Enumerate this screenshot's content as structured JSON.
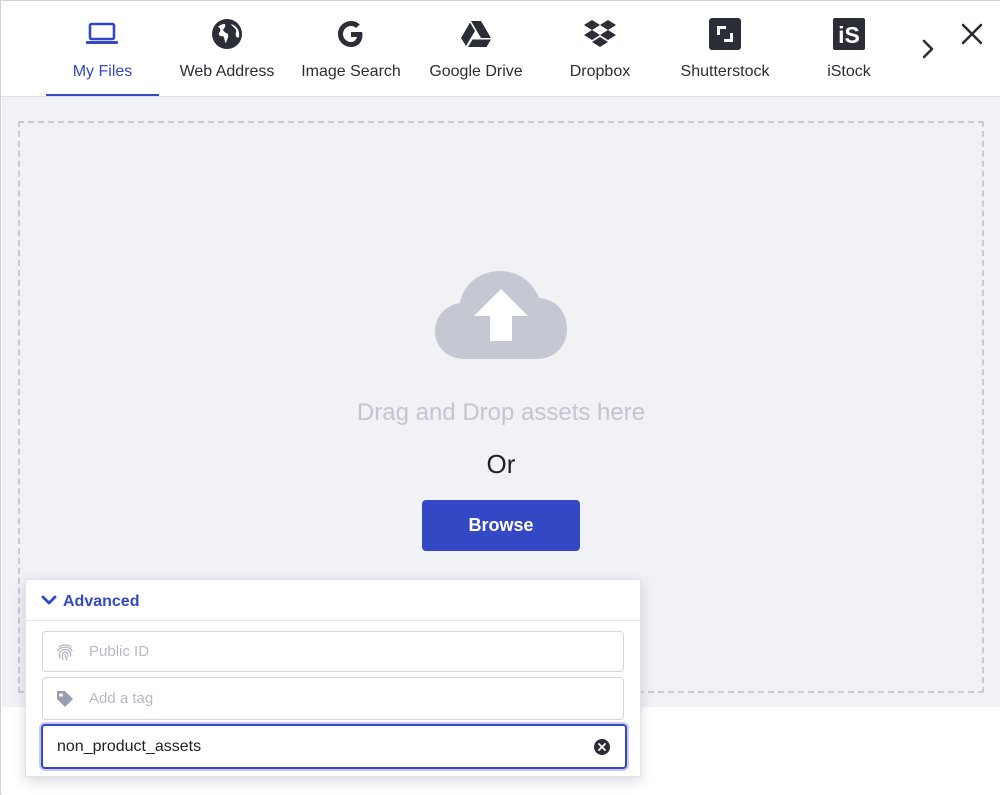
{
  "tabs": [
    {
      "id": "my-files",
      "label": "My Files",
      "icon": "laptop-icon",
      "active": true
    },
    {
      "id": "web-address",
      "label": "Web Address",
      "icon": "globe-icon",
      "active": false
    },
    {
      "id": "image-search",
      "label": "Image Search",
      "icon": "google-icon",
      "active": false
    },
    {
      "id": "google-drive",
      "label": "Google Drive",
      "icon": "google-drive-icon",
      "active": false
    },
    {
      "id": "dropbox",
      "label": "Dropbox",
      "icon": "dropbox-icon",
      "active": false
    },
    {
      "id": "shutterstock",
      "label": "Shutterstock",
      "icon": "shutterstock-icon",
      "active": false
    },
    {
      "id": "istock",
      "label": "iStock",
      "icon": "istock-icon",
      "active": false
    }
  ],
  "istock_logo_text": "iS",
  "dropzone": {
    "drag_text": "Drag and Drop assets here",
    "or_text": "Or",
    "browse_label": "Browse"
  },
  "advanced": {
    "title": "Advanced",
    "public_id_placeholder": "Public ID",
    "tag_placeholder": "Add a tag",
    "folder_value": "non_product_assets"
  },
  "colors": {
    "accent": "#3448c5",
    "icon_dark": "#2b2d37",
    "cloud": "#c5c8d2",
    "background": "#f1f2f6"
  }
}
